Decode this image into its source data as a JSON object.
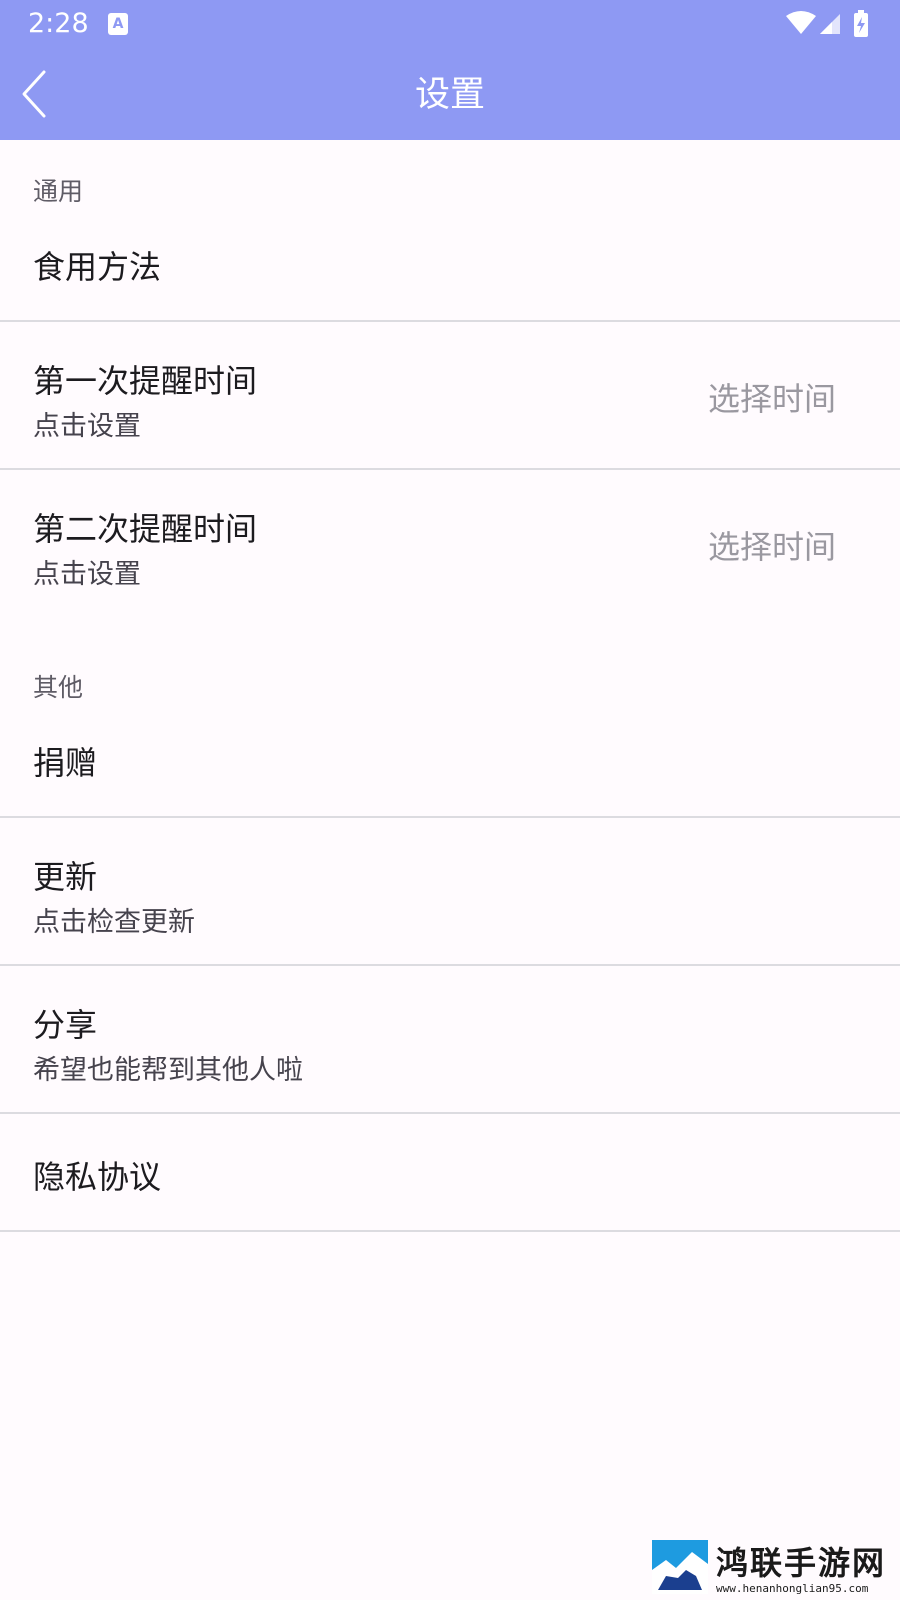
{
  "status_bar": {
    "time": "2:28",
    "notification_icon": "text-a-icon",
    "notification_glyph": "A",
    "right_icons": [
      "wifi-icon",
      "signal-icon",
      "battery-charging-icon"
    ]
  },
  "app_bar": {
    "back_icon": "chevron-left-icon",
    "title": "设置",
    "color": "#8e99f3"
  },
  "sections": [
    {
      "header": "通用",
      "rows": [
        {
          "title": "食用方法"
        },
        {
          "title": "第一次提醒时间",
          "subtitle": "点击设置",
          "trailing": "选择时间"
        },
        {
          "title": "第二次提醒时间",
          "subtitle": "点击设置",
          "trailing": "选择时间"
        }
      ]
    },
    {
      "header": "其他",
      "rows": [
        {
          "title": "捐赠"
        },
        {
          "title": "更新",
          "subtitle": "点击检查更新"
        },
        {
          "title": "分享",
          "subtitle": "希望也能帮到其他人啦"
        },
        {
          "title": "隐私协议"
        }
      ]
    }
  ],
  "watermark": {
    "name": "鸿联手游网",
    "url": "www.henanhonglian95.com"
  }
}
